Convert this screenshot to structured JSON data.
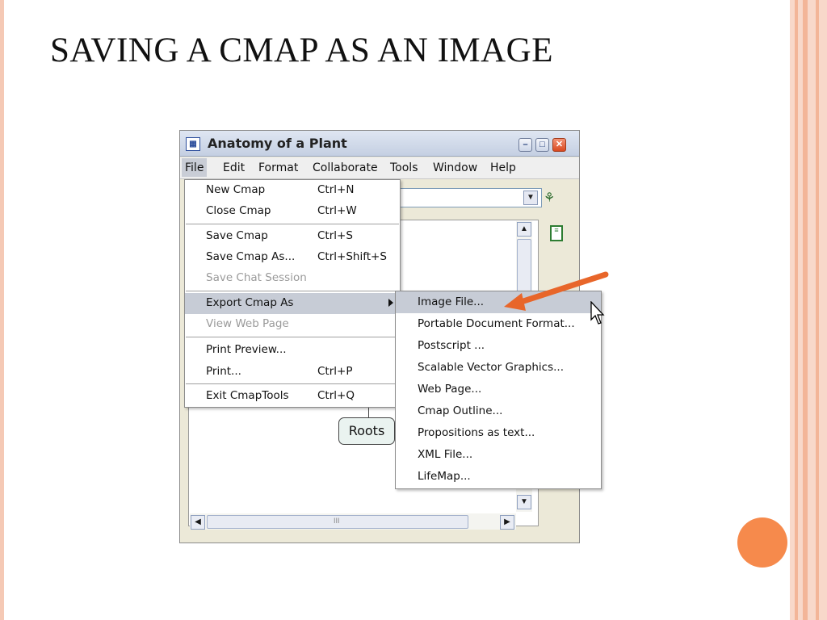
{
  "slide": {
    "title": "SAVING A CMAP AS AN IMAGE"
  },
  "window": {
    "title": "Anatomy of a Plant",
    "icon": "cmap-app-icon",
    "controls": {
      "minimize": "–",
      "maximize": "□",
      "close": "✕"
    }
  },
  "menubar": {
    "items": [
      "File",
      "Edit",
      "Format",
      "Collaborate",
      "Tools",
      "Window",
      "Help"
    ],
    "active": "File"
  },
  "file_menu": {
    "items": [
      {
        "label": "New Cmap",
        "shortcut": "Ctrl+N"
      },
      {
        "label": "Close Cmap",
        "shortcut": "Ctrl+W"
      },
      {
        "label": "Save Cmap",
        "shortcut": "Ctrl+S"
      },
      {
        "label": "Save Cmap As...",
        "shortcut": "Ctrl+Shift+S"
      },
      {
        "label": "Save Chat Session",
        "shortcut": "",
        "disabled": true
      },
      {
        "label": "Export Cmap As",
        "shortcut": "",
        "submenu": true,
        "highlighted": true
      },
      {
        "label": "View Web Page",
        "shortcut": "",
        "disabled": true
      },
      {
        "label": "Print Preview...",
        "shortcut": ""
      },
      {
        "label": "Print...",
        "shortcut": "Ctrl+P"
      },
      {
        "label": "Exit CmapTools",
        "shortcut": "Ctrl+Q"
      }
    ]
  },
  "export_submenu": {
    "items": [
      {
        "label": "Image File...",
        "highlighted": true
      },
      {
        "label": "Portable Document Format..."
      },
      {
        "label": "Postscript ..."
      },
      {
        "label": "Scalable Vector Graphics..."
      },
      {
        "label": "Web Page..."
      },
      {
        "label": "Cmap Outline..."
      },
      {
        "label": "Propositions as text..."
      },
      {
        "label": "XML File..."
      },
      {
        "label": "LifeMap..."
      }
    ]
  },
  "canvas": {
    "concept": "Roots",
    "scroll_grip": "III"
  },
  "colors": {
    "accent_orange": "#f68a4c",
    "menu_highlight": "#c7ccd6",
    "disabled_text": "#9a9a9a"
  }
}
